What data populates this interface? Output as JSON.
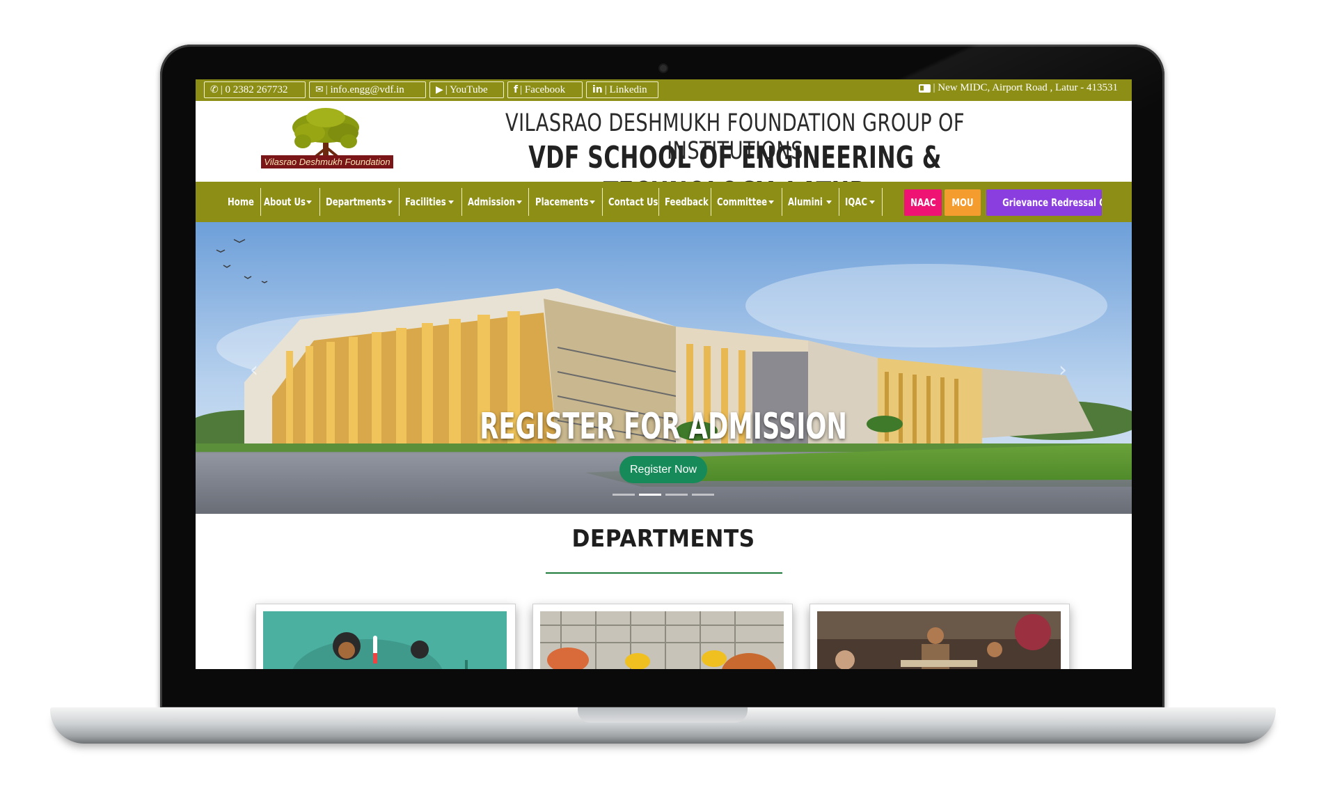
{
  "topbar": {
    "phone": "| 0 2382 267732",
    "email": "| info.engg@vdf.in",
    "youtube": "| YouTube",
    "facebook": "| Facebook",
    "linkedin": "| Linkedin",
    "address": "| New MIDC, Airport Road , Latur - 413531",
    "icons": [
      "phone-icon",
      "envelope-icon",
      "youtube-icon",
      "facebook-icon",
      "linkedin-icon",
      "id-card-icon"
    ]
  },
  "header": {
    "logo_text": "Vilasrao Deshmukh Foundation",
    "title_line1": "VILASRAO DESHMUKH FOUNDATION GROUP OF INSTITUTIONS",
    "title_line2": "VDF SCHOOL OF ENGINEERING & TECHNOLOGY, LATUR"
  },
  "nav": {
    "items": [
      {
        "label": "Home"
      },
      {
        "label": "About Us"
      },
      {
        "label": "Departments"
      },
      {
        "label": "Facilities"
      },
      {
        "label": "Admission"
      },
      {
        "label": "Placements"
      },
      {
        "label": "Contact Us"
      },
      {
        "label": "Feedback"
      },
      {
        "label": "Committee"
      },
      {
        "label": "Alumini"
      },
      {
        "label": "IQAC"
      }
    ],
    "badges": [
      {
        "label": "NAAC",
        "color": "#ef1373"
      },
      {
        "label": "MOU",
        "color": "#f59c2e"
      },
      {
        "label": "Grievance Redressal Cell",
        "color": "#8b3ee0"
      }
    ]
  },
  "hero": {
    "heading": "REGISTER FOR ADMISSION",
    "button_label": "Register Now",
    "slide_count": 4,
    "active_slide": 2
  },
  "departments": {
    "title": "DEPARTMENTS"
  },
  "colors": {
    "olive": "#8c8e16",
    "register_button": "#168a58"
  }
}
